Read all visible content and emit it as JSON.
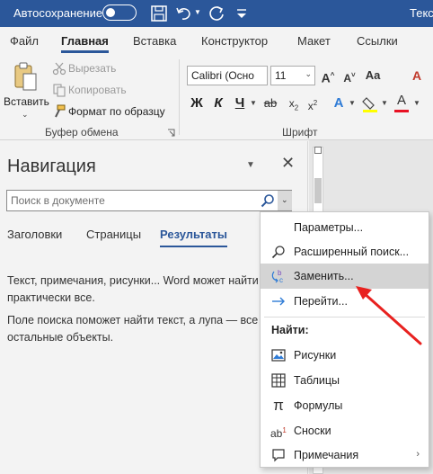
{
  "titlebar": {
    "autosave_label": "Автосохранение",
    "doc_title": "Текс"
  },
  "ribbon_tabs": [
    "Файл",
    "Главная",
    "Вставка",
    "Конструктор",
    "Макет",
    "Ссылки"
  ],
  "clipboard": {
    "paste_label": "Вставить",
    "cut_label": "Вырезать",
    "copy_label": "Копировать",
    "format_painter_label": "Формат по образцу",
    "group_label": "Буфер обмена"
  },
  "font": {
    "font_name": "Calibri (Осно",
    "font_size": "11",
    "bold": "Ж",
    "italic": "К",
    "underline": "Ч",
    "group_label": "Шрифт"
  },
  "navigation": {
    "title": "Навигация",
    "search_placeholder": "Поиск в документе",
    "tabs": [
      "Заголовки",
      "Страницы",
      "Результаты"
    ],
    "active_tab": "Результаты",
    "message1": "Текст, примечания, рисунки... Word может найти практически все.",
    "message2": "Поле поиска поможет найти текст, а лупа — все остальные объекты."
  },
  "menu": {
    "params": "Параметры...",
    "advanced_find": "Расширенный поиск...",
    "replace": "Заменить...",
    "goto": "Перейти...",
    "find_header": "Найти:",
    "pictures": "Рисунки",
    "tables": "Таблицы",
    "formulas": "Формулы",
    "footnotes": "Сноски",
    "comments": "Примечания"
  },
  "colors": {
    "accent": "#2b579a",
    "highlight": "#d4d4d4",
    "annotation_arrow": "#e8211f"
  }
}
